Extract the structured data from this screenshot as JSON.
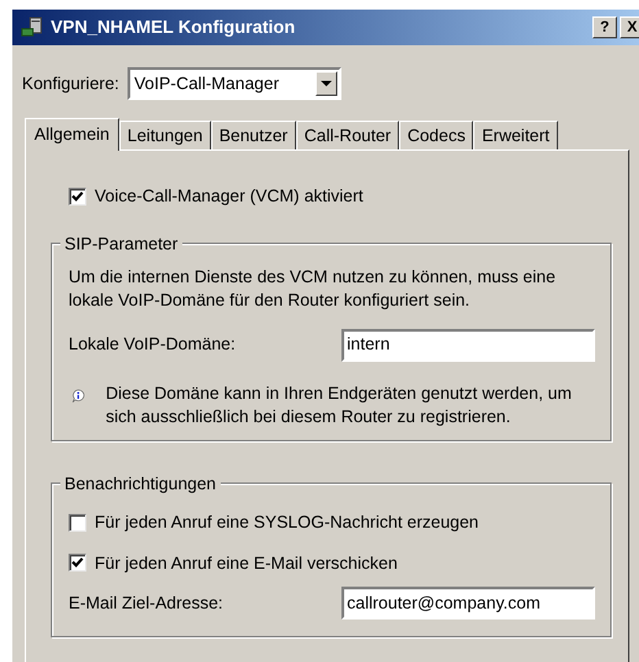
{
  "window": {
    "title": "VPN_NHAMEL Konfiguration",
    "buttons": [
      "?",
      "X"
    ]
  },
  "configure": {
    "label": "Konfiguriere:",
    "value": "VoIP-Call-Manager"
  },
  "tabs": [
    {
      "label": "Allgemein",
      "selected": true
    },
    {
      "label": "Leitungen",
      "selected": false
    },
    {
      "label": "Benutzer",
      "selected": false
    },
    {
      "label": "Call-Router",
      "selected": false
    },
    {
      "label": "Codecs",
      "selected": false
    },
    {
      "label": "Erweitert",
      "selected": false
    }
  ],
  "vcm_checkbox": {
    "label": "Voice-Call-Manager (VCM) aktiviert",
    "checked": true
  },
  "sip_group": {
    "title": "SIP-Parameter",
    "description": "Um die internen Dienste des VCM nutzen zu können, muss eine lokale VoIP-Domäne für den Router konfiguriert sein.",
    "domain_label": "Lokale VoIP-Domäne:",
    "domain_value": "intern",
    "info": "Diese Domäne kann in Ihren Endgeräten genutzt werden, um sich ausschließlich bei diesem Router zu registrieren."
  },
  "notifications_group": {
    "title": "Benachrichtigungen",
    "options": [
      {
        "label": "Für jeden Anruf eine SYSLOG-Nachricht erzeugen",
        "checked": false
      },
      {
        "label": "Für jeden Anruf eine E-Mail verschicken",
        "checked": true
      }
    ],
    "email_label": "E-Mail Ziel-Adresse:",
    "email_value": "callrouter@company.com"
  }
}
